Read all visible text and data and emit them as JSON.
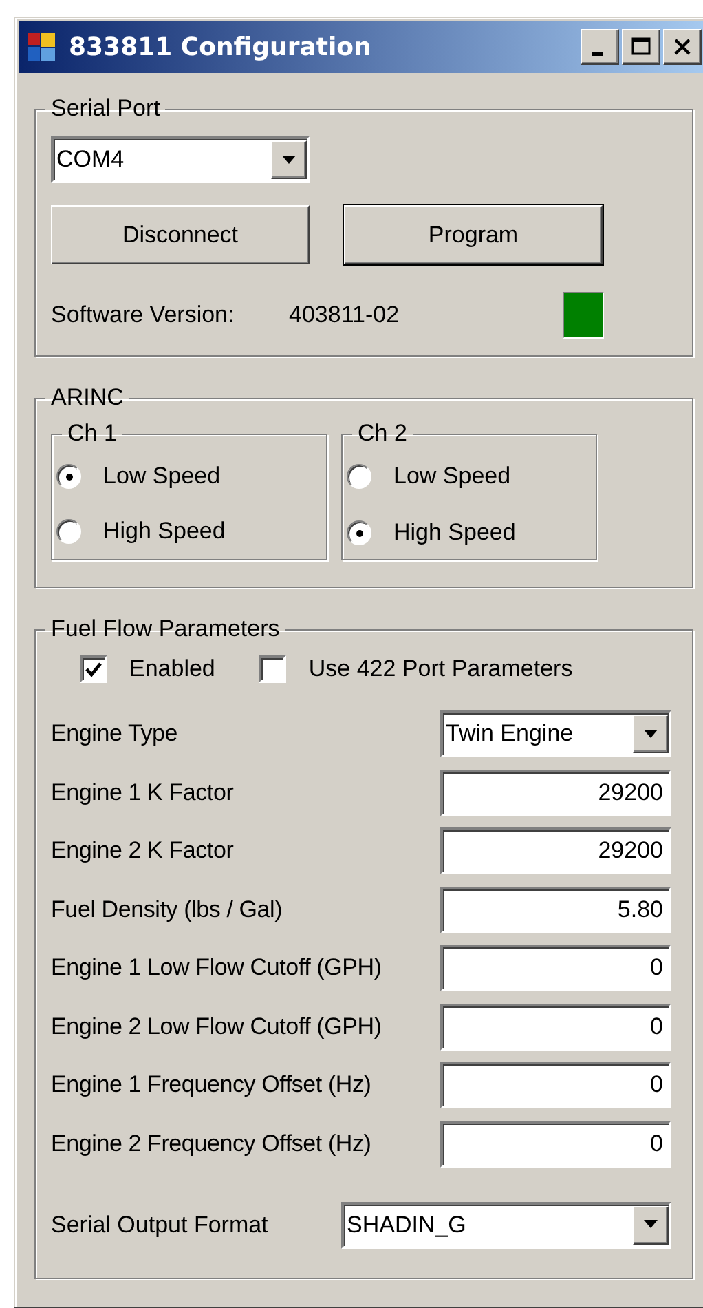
{
  "window": {
    "title": "833811 Configuration"
  },
  "serial_port": {
    "title": "Serial Port",
    "port": "COM4",
    "buttons": [
      {
        "label": "Disconnect",
        "default": false
      },
      {
        "label": "Program",
        "default": true
      }
    ],
    "version_label": "Software Version:",
    "version": "403811-02",
    "status_indicator": {
      "color": "#008000"
    }
  },
  "arinc": {
    "title": "ARINC",
    "channels": [
      {
        "title": "Ch 1",
        "options": [
          {
            "label": "Low Speed",
            "selected": true
          },
          {
            "label": "High Speed",
            "selected": false
          }
        ]
      },
      {
        "title": "Ch 2",
        "options": [
          {
            "label": "Low Speed",
            "selected": false
          },
          {
            "label": "High Speed",
            "selected": true
          }
        ]
      }
    ]
  },
  "fuel_flow": {
    "title": "Fuel Flow Parameters",
    "options": [
      {
        "label": "Enabled",
        "checked": true
      },
      {
        "label": "Use 422 Port Parameters",
        "checked": false
      }
    ],
    "fields": [
      {
        "kind": "dropdown",
        "label": "Engine Type",
        "value": "Twin Engine"
      },
      {
        "kind": "number",
        "label": "Engine 1 K Factor",
        "value": "29200"
      },
      {
        "kind": "number",
        "label": "Engine 2 K Factor",
        "value": "29200"
      },
      {
        "kind": "number",
        "label": "Fuel Density (lbs / Gal)",
        "value": "5.80"
      },
      {
        "kind": "number",
        "label": "Engine 1 Low Flow Cutoff (GPH)",
        "value": "0"
      },
      {
        "kind": "number",
        "label": "Engine 2 Low Flow Cutoff (GPH)",
        "value": "0"
      },
      {
        "kind": "number",
        "label": "Engine 1 Frequency Offset (Hz)",
        "value": "0"
      },
      {
        "kind": "number",
        "label": "Engine 2 Frequency Offset (Hz)",
        "value": "0"
      }
    ],
    "output_format": {
      "label": "Serial Output Format",
      "value": "SHADIN_G"
    }
  }
}
